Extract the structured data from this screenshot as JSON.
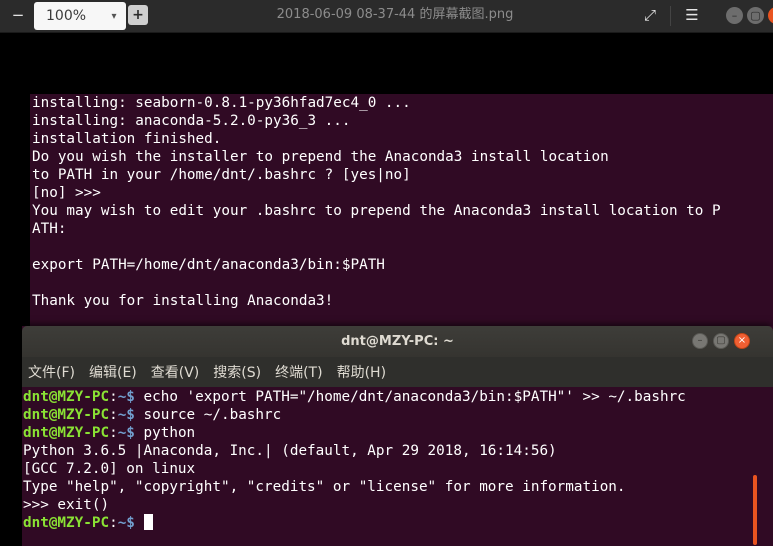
{
  "viewer": {
    "zoom": "100%",
    "zoom_minus_label": "−",
    "zoom_plus_label": "+",
    "title": "2018-06-09 08-37-44 的屏幕截图.png",
    "fullscreen_icon": "⤢",
    "menu_icon": "☰",
    "minimize_icon": "–",
    "maximize_icon": "▢",
    "close_icon": "×"
  },
  "back_terminal": {
    "lines": [
      "installing: seaborn-0.8.1-py36hfad7ec4_0 ...",
      "installing: anaconda-5.2.0-py36_3 ...",
      "installation finished.",
      "Do you wish the installer to prepend the Anaconda3 install location",
      "to PATH in your /home/dnt/.bashrc ? [yes|no]",
      "[no] >>>",
      "You may wish to edit your .bashrc to prepend the Anaconda3 install location to P",
      "ATH:",
      "",
      "export PATH=/home/dnt/anaconda3/bin:$PATH",
      "",
      "Thank you for installing Anaconda3!"
    ]
  },
  "front_terminal": {
    "title": "dnt@MZY-PC: ~",
    "menu": [
      "文件(F)",
      "编辑(E)",
      "查看(V)",
      "搜索(S)",
      "终端(T)",
      "帮助(H)"
    ],
    "prompt_user": "dnt@MZY-PC",
    "prompt_colon": ":",
    "prompt_path": "~$",
    "commands": [
      " echo 'export PATH=\"/home/dnt/anaconda3/bin:$PATH\"' >> ~/.bashrc",
      " source ~/.bashrc",
      " python"
    ],
    "output_lines": [
      "Python 3.6.5 |Anaconda, Inc.| (default, Apr 29 2018, 16:14:56)",
      "[GCC 7.2.0] on linux",
      "Type \"help\", \"copyright\", \"credits\" or \"license\" for more information.",
      ">>> exit()"
    ],
    "final_prompt_text": " "
  },
  "colors": {
    "terminal_bg": "#300a24",
    "prompt_user": "#8ae234",
    "prompt_path": "#729fcf",
    "accent": "#e95420"
  }
}
